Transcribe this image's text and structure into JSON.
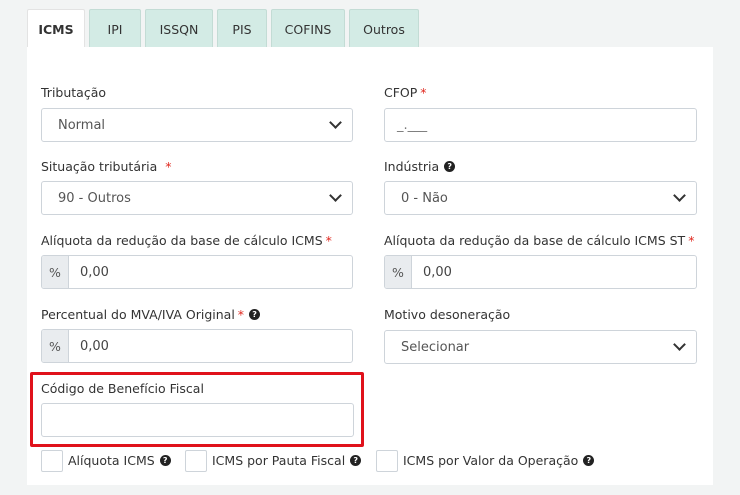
{
  "tabs": [
    "ICMS",
    "IPI",
    "ISSQN",
    "PIS",
    "COFINS",
    "Outros"
  ],
  "fields": {
    "tributacao": {
      "label": "Tributação",
      "value": "Normal"
    },
    "cfop": {
      "label": "CFOP",
      "required": "*",
      "value": "_.___"
    },
    "situacao": {
      "label": "Situação tributária",
      "required": "*",
      "value": "90 - Outros"
    },
    "industria": {
      "label": "Indústria",
      "value": "0 - Não"
    },
    "aliq_reducao": {
      "label": "Alíquota da redução da base de cálculo ICMS",
      "required": "*",
      "prefix": "%",
      "value": "0,00"
    },
    "aliq_reducao_st": {
      "label": "Alíquota da redução da base de cálculo ICMS ST",
      "required": "*",
      "prefix": "%",
      "value": "0,00"
    },
    "mva": {
      "label": "Percentual do MVA/IVA Original",
      "required": "*",
      "prefix": "%",
      "value": "0,00"
    },
    "motivo": {
      "label": "Motivo desoneração",
      "value": "Selecionar"
    },
    "beneficio": {
      "label": "Código de Benefício Fiscal",
      "value": ""
    }
  },
  "checkboxes": {
    "aliquota_icms": "Alíquota ICMS",
    "pauta_fiscal": "ICMS por Pauta Fiscal",
    "valor_operacao": "ICMS por Valor da Operação"
  },
  "help_glyph": "?",
  "colors": {
    "tab_inactive": "#d3ebe5",
    "required": "#e0281f",
    "highlight": "#e0111b"
  }
}
